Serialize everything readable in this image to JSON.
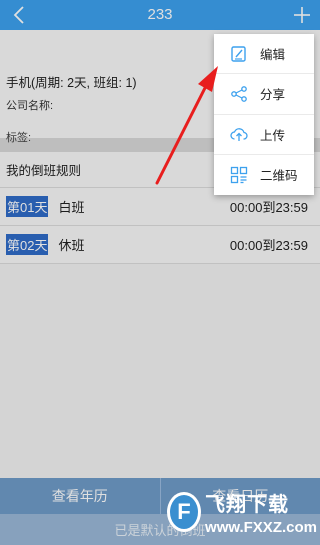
{
  "header": {
    "title": "233"
  },
  "info": {
    "phone_cycle": "手机(周期: 2天, 班组: 1)",
    "company_label": "公司名称:",
    "tags_label": "标签:"
  },
  "rules": {
    "title": "我的倒班规则",
    "rows": [
      {
        "day": "第01天",
        "shift": "白班",
        "time": "00:00到23:59"
      },
      {
        "day": "第02天",
        "shift": "休班",
        "time": "00:00到23:59"
      }
    ]
  },
  "bottom": {
    "year_calendar": "查看年历",
    "right_btn": "查看日历",
    "default_text": "已是默认的倒班"
  },
  "menu": {
    "items": [
      {
        "label": "编辑",
        "icon": "edit-icon"
      },
      {
        "label": "分享",
        "icon": "share-icon"
      },
      {
        "label": "上传",
        "icon": "upload-icon"
      },
      {
        "label": "二维码",
        "icon": "qrcode-icon"
      }
    ]
  },
  "watermark": {
    "title": "飞翔下载",
    "url": "www.FXXZ.com"
  },
  "colors": {
    "header": "#3da1ee",
    "accent": "#2f6cc8",
    "arrow": "#e81e1e",
    "icon": "#3da1ee"
  }
}
